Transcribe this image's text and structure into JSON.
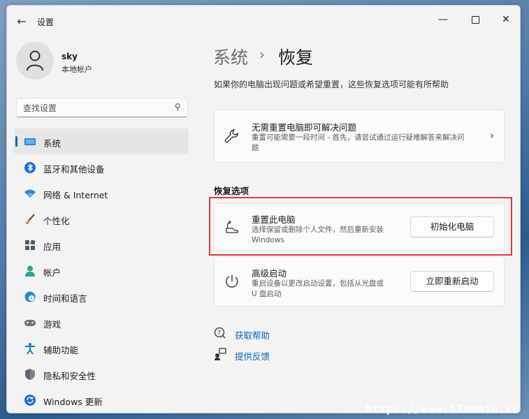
{
  "window": {
    "title": "设置"
  },
  "user": {
    "name": "sky",
    "account_type": "本地帐户"
  },
  "search": {
    "placeholder": "查找设置"
  },
  "sidebar": {
    "items": [
      {
        "label": "系统",
        "icon": "monitor-icon"
      },
      {
        "label": "蓝牙和其他设备",
        "icon": "bluetooth-icon"
      },
      {
        "label": "网络 & Internet",
        "icon": "wifi-icon"
      },
      {
        "label": "个性化",
        "icon": "brush-icon"
      },
      {
        "label": "应用",
        "icon": "apps-icon"
      },
      {
        "label": "帐户",
        "icon": "person-icon"
      },
      {
        "label": "时间和语言",
        "icon": "globe-clock-icon"
      },
      {
        "label": "游戏",
        "icon": "gamepad-icon"
      },
      {
        "label": "辅助功能",
        "icon": "accessibility-icon"
      },
      {
        "label": "隐私和安全性",
        "icon": "shield-icon"
      },
      {
        "label": "Windows 更新",
        "icon": "sync-icon"
      }
    ]
  },
  "breadcrumb": {
    "parent": "系统",
    "separator": "›",
    "current": "恢复"
  },
  "main": {
    "subtitle": "如果你的电脑出现问题或希望重置，这些恢复选项可能有所帮助",
    "troubleshoot": {
      "title": "无需重置电脑即可解决问题",
      "desc_line1": "重置可能需要一段时间 - 首先，请尝试通过运行疑难解答来解决问",
      "desc_line2": "题"
    },
    "section_header": "恢复选项",
    "reset": {
      "title": "重置此电脑",
      "desc_line1": "选择保留或删除个人文件，然后重新安装",
      "desc_line2": "Windows",
      "button": "初始化电脑"
    },
    "advanced": {
      "title": "高级启动",
      "desc_line1": "重启设备以更改启动设置，包括从光盘或",
      "desc_line2": "U 盘启动",
      "button": "立即重新启动"
    },
    "links": {
      "help": "获取帮助",
      "feedback": "提供反馈"
    }
  },
  "watermark": "https://www.i7admin.cc",
  "colors": {
    "accent": "#0067c0",
    "highlight": "#e0393e"
  }
}
